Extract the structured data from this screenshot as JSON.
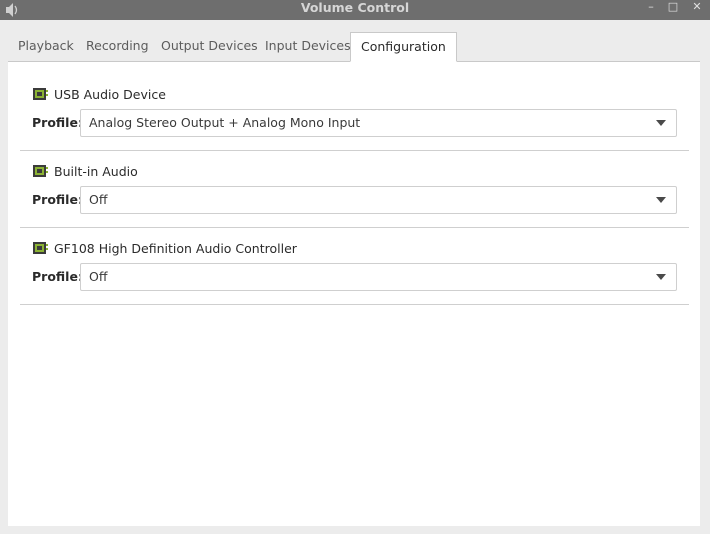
{
  "window": {
    "title": "Volume Control",
    "icon": "speaker-icon",
    "controls": {
      "minimize": "–",
      "maximize": "□",
      "close": "✕"
    }
  },
  "tabs": [
    {
      "label": "Playback",
      "active": false
    },
    {
      "label": "Recording",
      "active": false
    },
    {
      "label": "Output Devices",
      "active": false
    },
    {
      "label": "Input Devices",
      "active": false
    },
    {
      "label": "Configuration",
      "active": true
    }
  ],
  "cards": [
    {
      "name": "USB Audio Device",
      "profile_label": "Profile:",
      "profile_value": "Analog Stereo Output + Analog Mono Input",
      "icon": "sound-card-icon"
    },
    {
      "name": "Built-in Audio",
      "profile_label": "Profile:",
      "profile_value": "Off",
      "icon": "sound-card-icon"
    },
    {
      "name": "GF108 High Definition Audio Controller",
      "profile_label": "Profile:",
      "profile_value": "Off",
      "icon": "sound-card-icon"
    }
  ],
  "colors": {
    "titlebar": "#6e6e6e",
    "card_icon_green": "#8cb334",
    "card_icon_dark": "#3b3b3b"
  }
}
